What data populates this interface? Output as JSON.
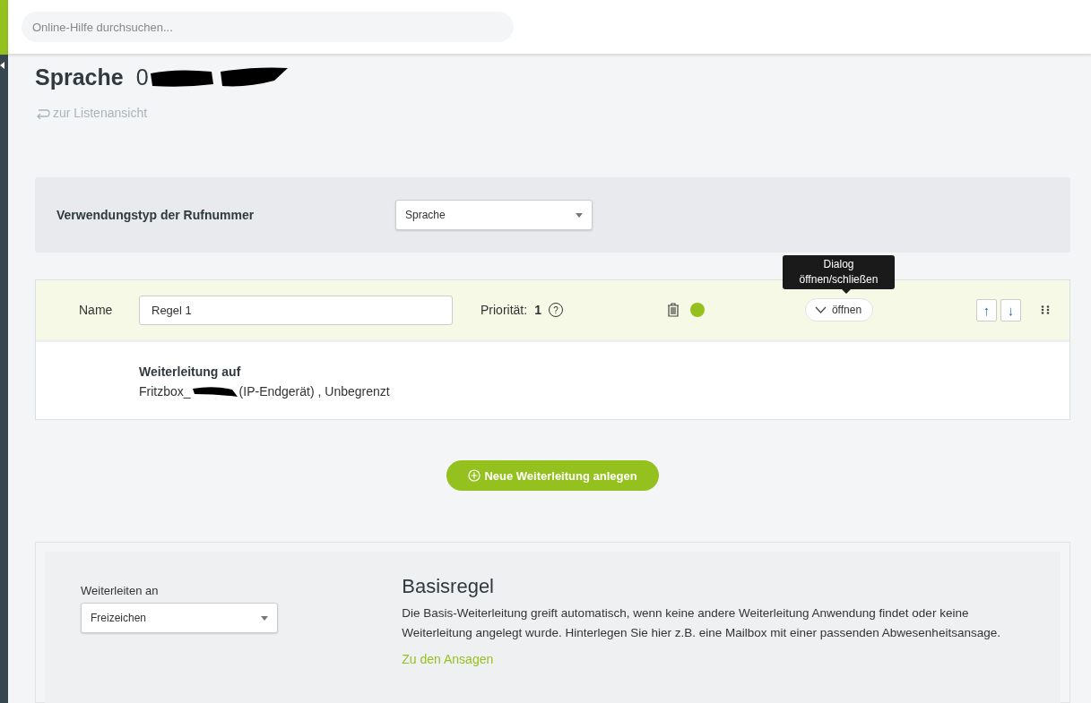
{
  "search": {
    "placeholder": "Online-Hilfe durchsuchen..."
  },
  "page": {
    "title": "Sprache",
    "number_visible": "0",
    "back_link": "zur Listenansicht"
  },
  "usage": {
    "label": "Verwendungstyp der Rufnummer",
    "value": "Sprache"
  },
  "rule": {
    "name_label": "Name",
    "name_value": "Regel 1",
    "priority_label": "Priorität:",
    "priority": "1",
    "help": "?",
    "active": true,
    "toggle_label": "öffnen",
    "tooltip": "Dialog öffnen/schließen",
    "up": "↑",
    "down": "↓",
    "target_title": "Weiterleitung auf",
    "target_prefix": "Fritzbox_",
    "target_rest": "(IP-Endgerät) , Unbegrenzt"
  },
  "new_button": "Neue Weiterleitung anlegen",
  "base": {
    "field_label": "Weiterleiten an",
    "field_value": "Freizeichen",
    "title": "Basisregel",
    "text": "Die Basis-Weiterleitung greift automatisch, wenn keine andere Weiterleitung Anwendung findet oder keine Weiterleitung angelegt wurde. Hinterlegen Sie hier z.B. eine Mailbox mit einer passenden Abwesenheitsansage.",
    "link": "Zu den Ansagen"
  }
}
